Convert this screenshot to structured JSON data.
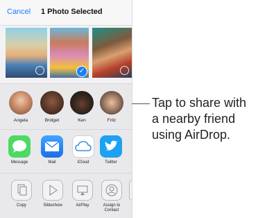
{
  "header": {
    "cancel_label": "Cancel",
    "title": "1 Photo Selected"
  },
  "photos": [
    {
      "name": "photo-1",
      "selected": false,
      "live_badge": true
    },
    {
      "name": "photo-2",
      "selected": true,
      "live_badge": false
    },
    {
      "name": "photo-3",
      "selected": false,
      "live_badge": true
    }
  ],
  "airdrop_people": [
    {
      "label": "Angela",
      "color": "#c98a6a"
    },
    {
      "label": "Bridget",
      "color": "#6b4a3a"
    },
    {
      "label": "Ken",
      "color": "#3a2a22"
    },
    {
      "label": "Fritz",
      "color": "#8a7060"
    }
  ],
  "apps": [
    {
      "label": "Message",
      "icon": "message-bubble-icon",
      "color": "#4cd964"
    },
    {
      "label": "Mail",
      "icon": "envelope-icon",
      "color": "#1e88f5"
    },
    {
      "label": "iCloud",
      "icon": "cloud-icon",
      "color": "#ffffff"
    },
    {
      "label": "Twitter",
      "icon": "twitter-bird-icon",
      "color": "#1da1f2"
    }
  ],
  "actions": [
    {
      "label": "Copy",
      "icon": "copy-icon"
    },
    {
      "label": "Slideshow",
      "icon": "play-icon"
    },
    {
      "label": "AirPlay",
      "icon": "airplay-icon"
    },
    {
      "label": "Assign to Contact",
      "icon": "contact-icon"
    }
  ],
  "callout": {
    "line1": "Tap to share with",
    "line2": "a nearby friend",
    "line3": "using AirDrop."
  },
  "colors": {
    "accent": "#1a7ff6",
    "sheet_bg": "#f2f2f4"
  }
}
